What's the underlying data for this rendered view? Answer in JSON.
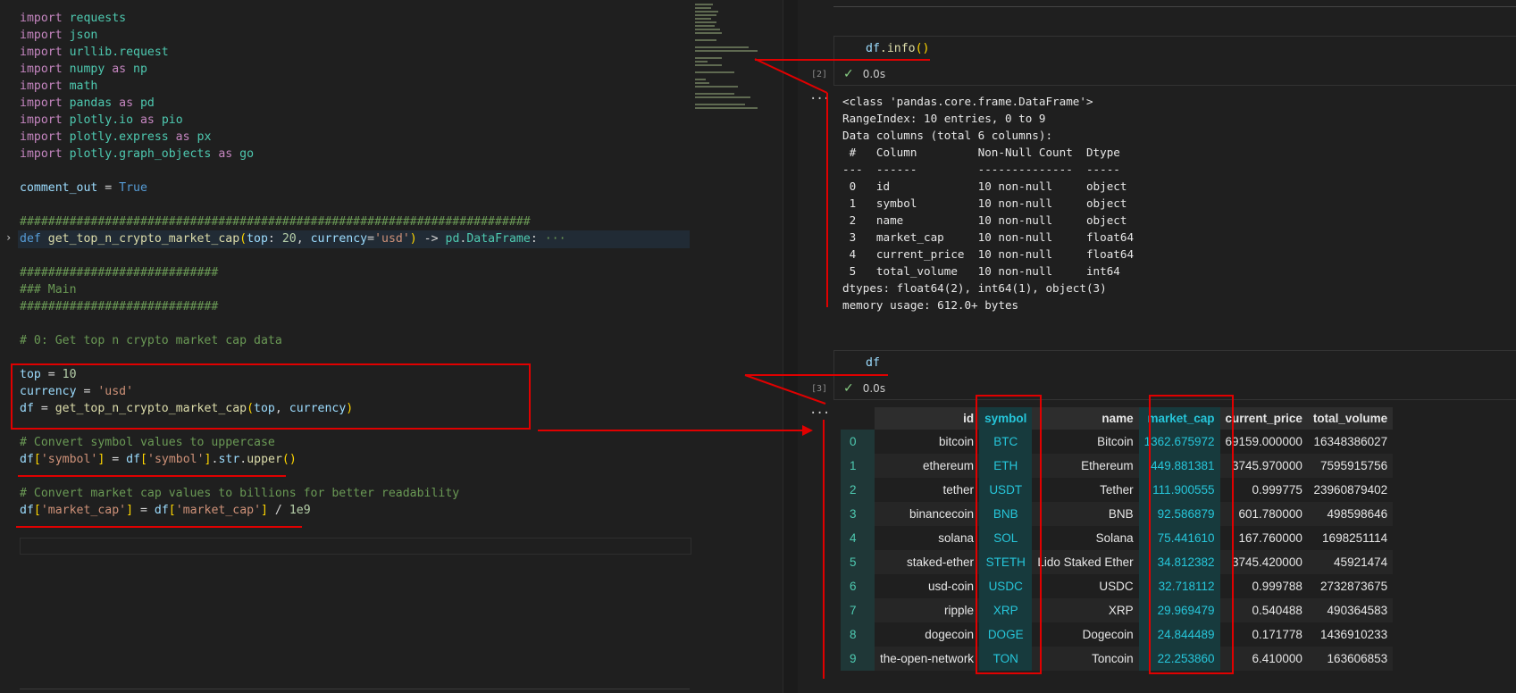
{
  "editor": {
    "lines": [
      [
        "kw:import",
        "mod: requests"
      ],
      [
        "kw:import",
        "mod: json"
      ],
      [
        "kw:import",
        "mod: urllib.request"
      ],
      [
        "kw:import",
        "mod: numpy",
        "kw: as",
        "alias: np"
      ],
      [
        "kw:import",
        "mod: math"
      ],
      [
        "kw:import",
        "mod: pandas",
        "kw: as",
        "alias: pd"
      ],
      [
        "kw:import",
        "mod: plotly.io",
        "kw: as",
        "alias: pio"
      ],
      [
        "kw:import",
        "mod: plotly.express",
        "kw: as",
        "alias: px"
      ],
      [
        "kw:import",
        "mod: plotly.graph_objects",
        "kw: as",
        "alias: go"
      ],
      [],
      [
        "var:comment_out",
        "op: = ",
        "bool:True"
      ],
      [],
      [
        "cm:########################################################################"
      ],
      [
        "def:def",
        "fn: get_top_n_crypto_market_cap",
        "paren:(",
        "var:top",
        "op:: ",
        "num:20",
        "op:, ",
        "var:currency",
        "op:=",
        "str:'usd'",
        "paren:)",
        "op: -> ",
        "mod:pd",
        "op:.",
        "mod:DataFrame",
        "op::",
        "cm: ···"
      ],
      [],
      [
        "cm:############################"
      ],
      [
        "cm:### Main"
      ],
      [
        "cm:############################"
      ],
      [],
      [
        "cm:# 0: Get top n crypto market cap data"
      ],
      [],
      [
        "var:top",
        "op: = ",
        "num:10"
      ],
      [
        "var:currency",
        "op: = ",
        "str:'usd'"
      ],
      [
        "var:df",
        "op: = ",
        "fn:get_top_n_crypto_market_cap",
        "paren:(",
        "var:top",
        "op:, ",
        "var:currency",
        "paren:)"
      ],
      [],
      [
        "cm:# Convert symbol values to uppercase"
      ],
      [
        "var:df",
        "paren:[",
        "str:'symbol'",
        "paren:]",
        "op: = ",
        "var:df",
        "paren:[",
        "str:'symbol'",
        "paren:]",
        "op:.",
        "var:str",
        "op:.",
        "fn:upper",
        "paren:()"
      ],
      [],
      [
        "cm:# Convert market cap values to billions for better readability"
      ],
      [
        "var:df",
        "paren:[",
        "str:'market_cap'",
        "paren:]",
        "op: = ",
        "var:df",
        "paren:[",
        "str:'market_cap'",
        "paren:]",
        "op: / ",
        "num:1e9"
      ]
    ]
  },
  "cell_info": {
    "code_var": "df",
    "code_method": ".info",
    "code_paren": "()",
    "exec_count": "[2]",
    "status": "0.0s",
    "output": "<class 'pandas.core.frame.DataFrame'>\nRangeIndex: 10 entries, 0 to 9\nData columns (total 6 columns):\n #   Column         Non-Null Count  Dtype  \n---  ------         --------------  -----  \n 0   id             10 non-null     object \n 1   symbol         10 non-null     object \n 2   name           10 non-null     object \n 3   market_cap     10 non-null     float64\n 4   current_price  10 non-null     float64\n 5   total_volume   10 non-null     int64  \ndtypes: float64(2), int64(1), object(3)\nmemory usage: 612.0+ bytes"
  },
  "cell_df": {
    "code": "df",
    "exec_count": "[3]",
    "status": "0.0s",
    "columns": [
      "id",
      "symbol",
      "name",
      "market_cap",
      "current_price",
      "total_volume"
    ],
    "rows": [
      [
        "0",
        "bitcoin",
        "BTC",
        "Bitcoin",
        "1362.675972",
        "69159.000000",
        "16348386027"
      ],
      [
        "1",
        "ethereum",
        "ETH",
        "Ethereum",
        "449.881381",
        "3745.970000",
        "7595915756"
      ],
      [
        "2",
        "tether",
        "USDT",
        "Tether",
        "111.900555",
        "0.999775",
        "23960879402"
      ],
      [
        "3",
        "binancecoin",
        "BNB",
        "BNB",
        "92.586879",
        "601.780000",
        "498598646"
      ],
      [
        "4",
        "solana",
        "SOL",
        "Solana",
        "75.441610",
        "167.760000",
        "1698251114"
      ],
      [
        "5",
        "staked-ether",
        "STETH",
        "Lido Staked Ether",
        "34.812382",
        "3745.420000",
        "45921474"
      ],
      [
        "6",
        "usd-coin",
        "USDC",
        "USDC",
        "32.718112",
        "0.999788",
        "2732873675"
      ],
      [
        "7",
        "ripple",
        "XRP",
        "XRP",
        "29.969479",
        "0.540488",
        "490364583"
      ],
      [
        "8",
        "dogecoin",
        "DOGE",
        "Dogecoin",
        "24.844489",
        "0.171778",
        "1436910233"
      ],
      [
        "9",
        "the-open-network",
        "TON",
        "Toncoin",
        "22.253860",
        "6.410000",
        "163606853"
      ]
    ]
  },
  "colors": {
    "accent_red": "#e00000",
    "teal_highlight": "#26c6da",
    "success": "#89d185"
  }
}
